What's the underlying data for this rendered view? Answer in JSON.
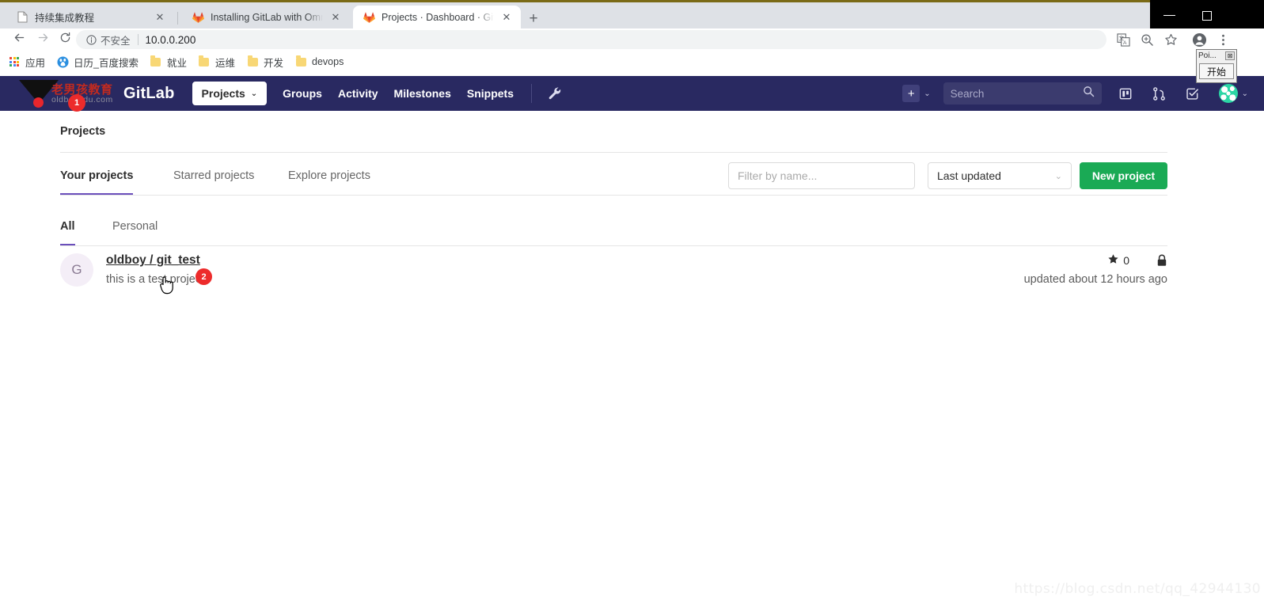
{
  "browser": {
    "tabs": [
      {
        "title": "持续集成教程",
        "favicon": "document-icon",
        "active": false,
        "close_label": "✕"
      },
      {
        "title": "Installing GitLab with Omnibus",
        "favicon": "gitlab-icon",
        "active": false,
        "close_label": "✕"
      },
      {
        "title": "Projects · Dashboard · GitLab",
        "favicon": "gitlab-icon",
        "active": true,
        "close_label": "✕"
      }
    ],
    "new_tab_label": "+",
    "window_controls": {
      "minimize": "minimize-icon",
      "maximize": "maximize-icon"
    },
    "toolbar": {
      "back": "back-arrow-icon",
      "forward": "forward-arrow-icon",
      "reload": "reload-icon",
      "security_label": "不安全",
      "url": "10.0.0.200",
      "icons": [
        "translate-icon",
        "zoom-icon",
        "bookmark-star-icon",
        "profile-icon",
        "more-menu-icon"
      ]
    },
    "bookmarks": [
      {
        "label": "应用",
        "icon": "apps-grid-icon"
      },
      {
        "label": "日历_百度搜索",
        "icon": "baidu-icon"
      },
      {
        "label": "就业",
        "icon": "folder-icon"
      },
      {
        "label": "运维",
        "icon": "folder-icon"
      },
      {
        "label": "开发",
        "icon": "folder-icon"
      },
      {
        "label": "devops",
        "icon": "folder-icon"
      }
    ]
  },
  "gitlab_nav": {
    "watermark_cn": "老男孩教育",
    "watermark_en": "oldboyedu.com",
    "brand": "GitLab",
    "projects_button": "Projects",
    "projects_chevron": "⌄",
    "links": [
      "Groups",
      "Activity",
      "Milestones",
      "Snippets"
    ],
    "admin_icon": "wrench-icon",
    "plus_label": "+",
    "plus_chevron": "⌄",
    "search_placeholder": "Search",
    "search_icon": "search-icon",
    "right_icons": [
      "issue-boards-icon",
      "merge-requests-icon",
      "todos-icon"
    ],
    "avatar_chevron": "⌄",
    "badge_1": "1"
  },
  "page": {
    "title": "Projects",
    "tabs": [
      {
        "label": "Your projects",
        "active": true
      },
      {
        "label": "Starred projects",
        "active": false
      },
      {
        "label": "Explore projects",
        "active": false
      }
    ],
    "filter_placeholder": "Filter by name...",
    "sort_value": "Last updated",
    "sort_chevron": "⌄",
    "new_project_label": "New project",
    "subtabs": [
      {
        "label": "All",
        "active": true
      },
      {
        "label": "Personal",
        "active": false
      }
    ],
    "projects": [
      {
        "avatar_letter": "G",
        "name": "oldboy / git_test",
        "description": "this is a test project",
        "stars": "0",
        "star_icon": "star-icon",
        "visibility_icon": "lock-icon",
        "updated": "updated about 12 hours ago",
        "badge": "2"
      }
    ]
  },
  "poi_widget": {
    "title": "Poi...",
    "close_label": "⊠",
    "start_label": "开始"
  },
  "watermark": "https://blog.csdn.net/qq_42944130",
  "colors": {
    "navbar": "#292961",
    "accent_purple": "#6b4fbb",
    "green": "#1aaa55",
    "badge_red": "#ed2b2b",
    "tabstrip": "#dee1e6"
  }
}
